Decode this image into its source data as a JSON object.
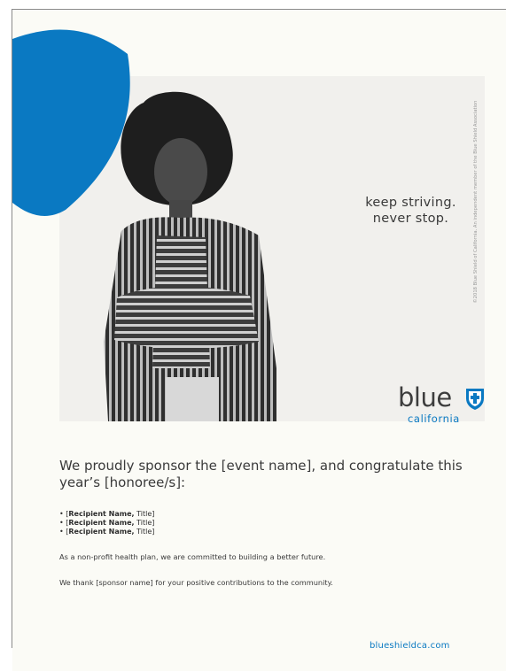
{
  "ad": {
    "tagline_line1": "keep striving.",
    "tagline_line2": "never stop.",
    "copyright": "©2018 Blue Shield of California. An independent member of the Blue Shield Association",
    "logo_word": "blue",
    "logo_sub": "california",
    "shield_color": "#0a79c2",
    "photo_subject": "woman with natural curly hair and arms crossed wearing a striped jacket (black and white photograph)"
  },
  "copy": {
    "headline": "We proudly sponsor the [event name], and congratulate this year’s [honoree/s]:",
    "recipients": [
      {
        "name": "Recipient Name,",
        "title": "Title"
      },
      {
        "name": "Recipient Name,",
        "title": "Title"
      },
      {
        "name": "Recipient Name,",
        "title": "Title"
      }
    ],
    "paragraph1": "As a non-profit health plan, we are committed to building a better future.",
    "paragraph2": "We thank [sponsor name] for your positive contributions to the community.",
    "website": "blueshieldca.com"
  },
  "colors": {
    "accent": "#0a79c2",
    "text": "#3a3a3a",
    "page": "#fbfbf6"
  }
}
